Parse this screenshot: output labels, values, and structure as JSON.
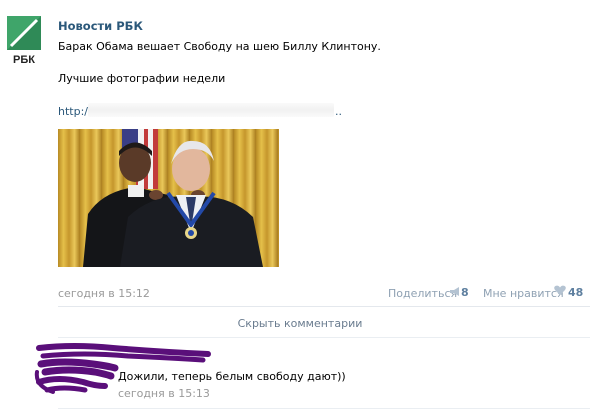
{
  "post": {
    "author": "Новости РБК",
    "logo_text": "РБК",
    "text_line1": "Барак Обама вешает Свободу на шею Биллу Клинтону.",
    "text_line2": "Лучшие фотографии недели",
    "link_prefix": "http:/",
    "link_suffix": "..",
    "date": "сегодня в 15:12",
    "share_label": "Поделиться",
    "share_count": "8",
    "like_label": "Мне нравится",
    "like_count": "48"
  },
  "comments": {
    "hide_label": "Скрыть комментарии",
    "items": [
      {
        "text": "Дожили, теперь белым свободу дают))",
        "date": "сегодня в 15:13"
      }
    ]
  },
  "icons": {
    "share": "megaphone-icon",
    "like": "heart-icon"
  },
  "colors": {
    "link": "#2b587a",
    "muted": "#999999",
    "count": "#5f80a0",
    "scribble": "#5a0f7a"
  }
}
